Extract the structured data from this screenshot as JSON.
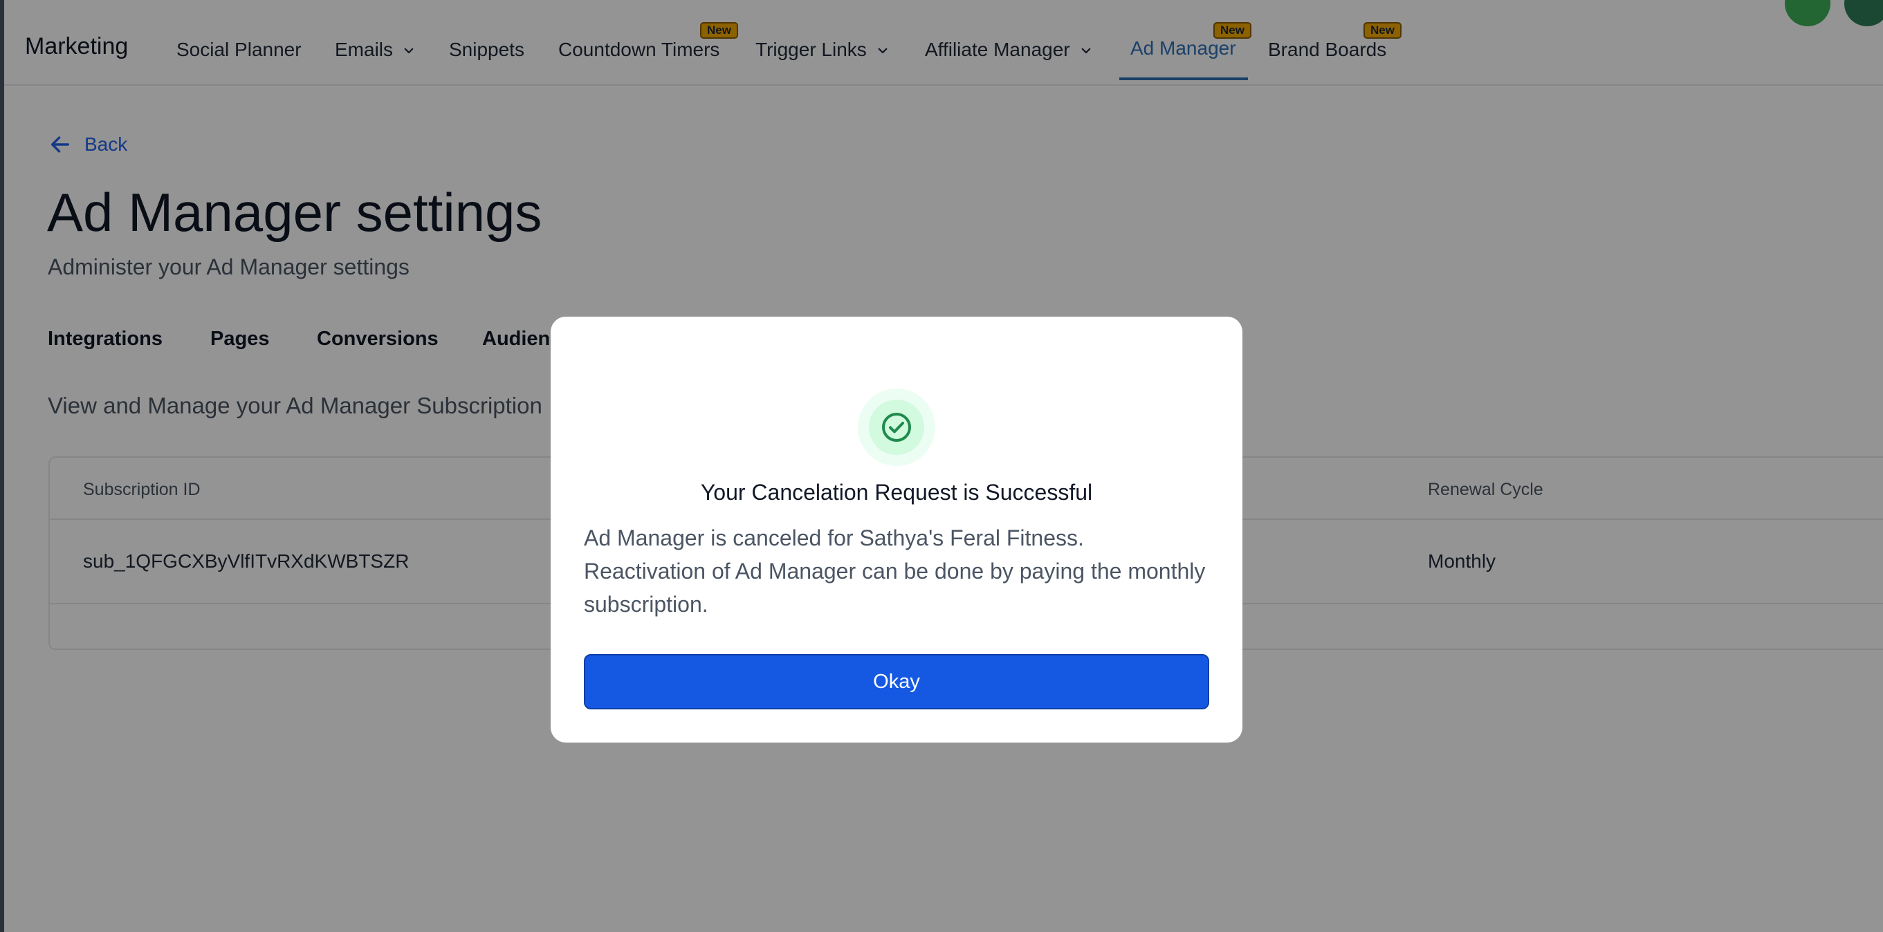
{
  "nav": {
    "brand": "Marketing",
    "items": [
      {
        "label": "Social Planner"
      },
      {
        "label": "Emails"
      },
      {
        "label": "Snippets"
      },
      {
        "label": "Countdown Timers",
        "badge": "New"
      },
      {
        "label": "Trigger Links"
      },
      {
        "label": "Affiliate Manager"
      },
      {
        "label": "Ad Manager",
        "badge": "New"
      },
      {
        "label": "Brand Boards",
        "badge": "New"
      }
    ],
    "active": "Ad Manager"
  },
  "content": {
    "back_label": "Back",
    "title": "Ad Manager settings",
    "subtitle": "Administer your Ad Manager settings",
    "tabs": [
      {
        "label": "Integrations"
      },
      {
        "label": "Pages"
      },
      {
        "label": "Conversions"
      },
      {
        "label": "Audiences"
      }
    ],
    "section_description": "View and Manage your Ad Manager Subscription",
    "table": {
      "columns": [
        "Subscription ID",
        "Renewal Cycle"
      ],
      "rows": [
        {
          "subscription_id": "sub_1QFGCXByVlfITvRXdKWBTSZR",
          "renewal_cycle": "Monthly"
        }
      ]
    }
  },
  "modal": {
    "icon": "check-circle-icon",
    "title": "Your Cancelation Request is Successful",
    "body": "Ad Manager is canceled for Sathya's Feral Fitness. Reactivation of Ad Manager can be done by paying the monthly subscription.",
    "button_label": "Okay"
  },
  "colors": {
    "accent": "#2f6fb5",
    "primary_button": "#1559e3",
    "badge": "#f2a900",
    "success": "#1f8a4c"
  }
}
